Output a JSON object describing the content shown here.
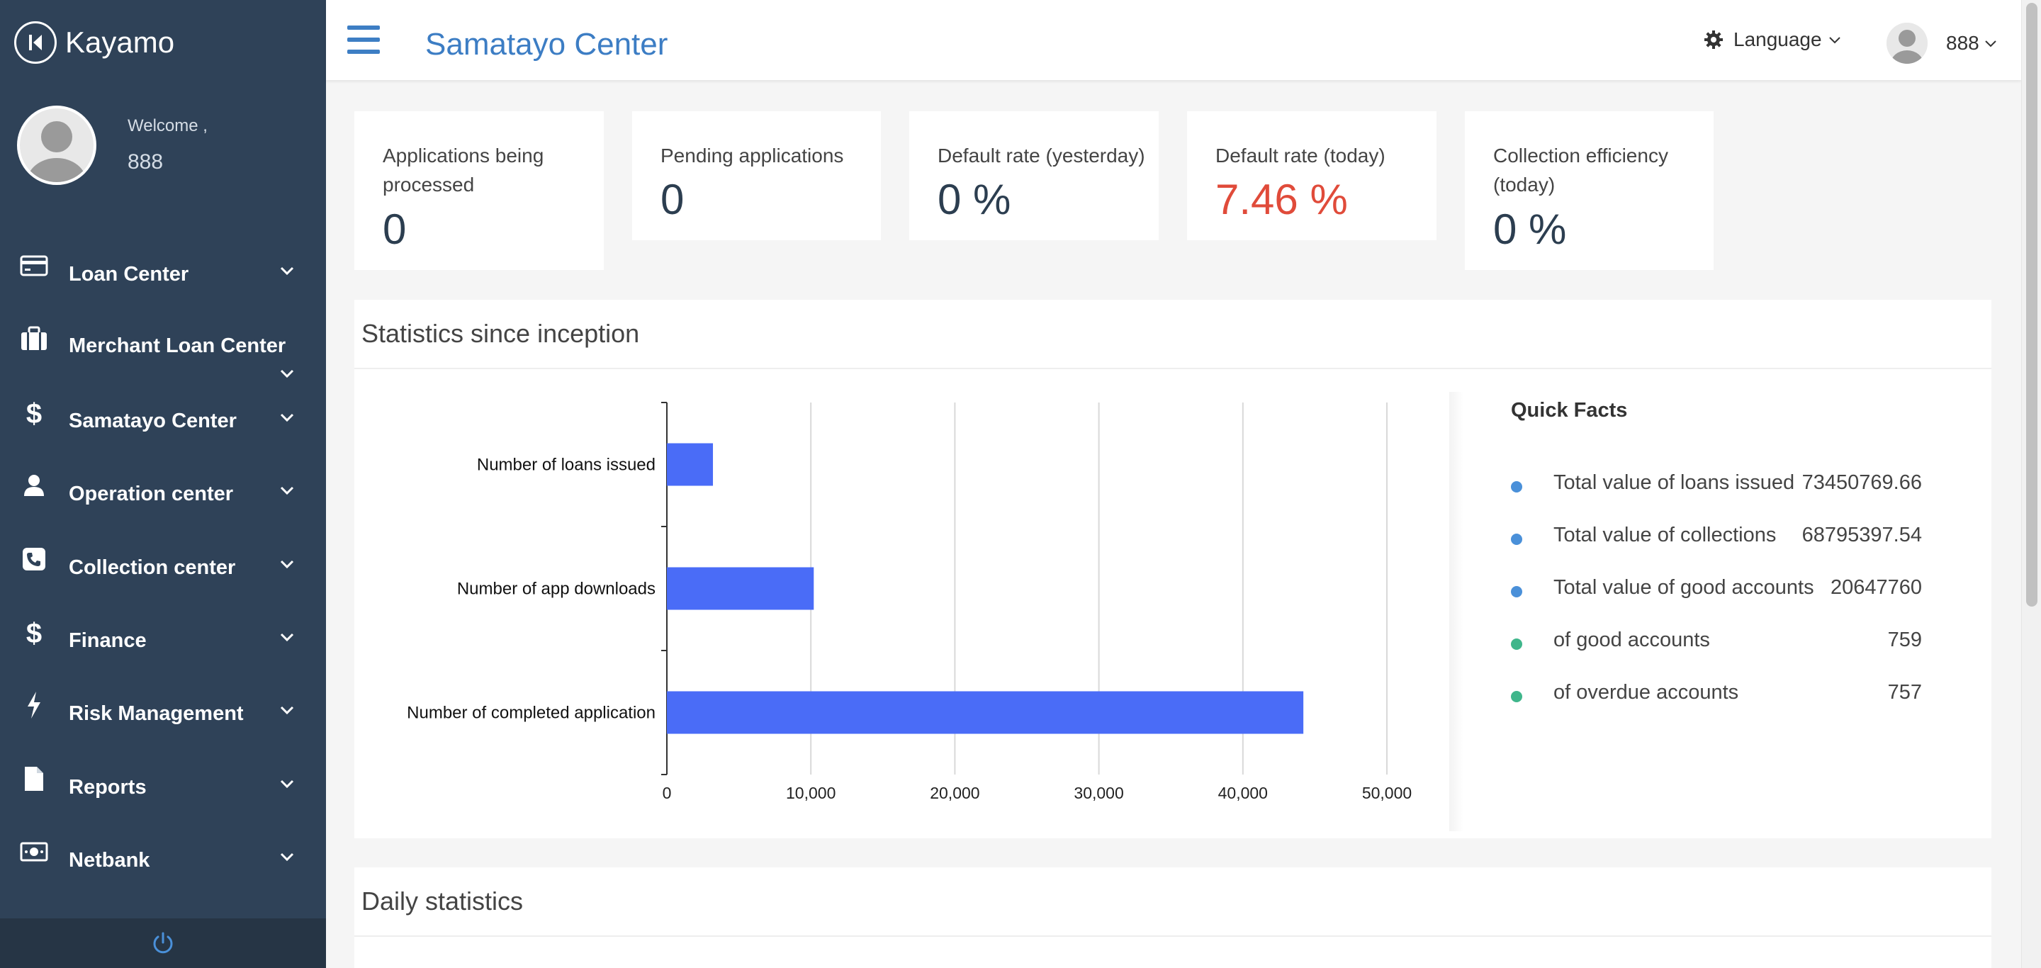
{
  "brand": {
    "name": "Kayamo"
  },
  "profile": {
    "welcome": "Welcome ,",
    "username": "888"
  },
  "sidebar": {
    "items": [
      {
        "label": "Loan Center",
        "icon": "credit-card-icon"
      },
      {
        "label": "Merchant Loan Center",
        "icon": "briefcase-icon"
      },
      {
        "label": "Samatayo Center",
        "icon": "dollar-icon"
      },
      {
        "label": "Operation center",
        "icon": "user-icon"
      },
      {
        "label": "Collection center",
        "icon": "phone-icon"
      },
      {
        "label": "Finance",
        "icon": "dollar-icon"
      },
      {
        "label": "Risk Management",
        "icon": "bolt-icon"
      },
      {
        "label": "Reports",
        "icon": "file-icon"
      },
      {
        "label": "Netbank",
        "icon": "money-icon"
      }
    ]
  },
  "topbar": {
    "title": "Samatayo Center",
    "language_label": "Language",
    "username": "888"
  },
  "cards": [
    {
      "label": "Applications being processed",
      "value": "0"
    },
    {
      "label": "Pending applications",
      "value": "0"
    },
    {
      "label": "Default rate (yesterday)",
      "value": "0 %"
    },
    {
      "label": "Default rate (today)",
      "value": "7.46 %"
    },
    {
      "label": "Collection efficiency (today)",
      "value": "0 %"
    }
  ],
  "stats_panel": {
    "title": "Statistics since inception"
  },
  "daily_panel": {
    "title": "Daily statistics"
  },
  "quick_facts": {
    "title": "Quick Facts",
    "items": [
      {
        "label": "Total value of loans issued",
        "value": "73450769.66",
        "color": "#4a90d9"
      },
      {
        "label": "Total value of collections",
        "value": "68795397.54",
        "color": "#4a90d9"
      },
      {
        "label": "Total value of good accounts",
        "value": "20647760",
        "color": "#4a90d9"
      },
      {
        "label": "of good accounts",
        "value": "759",
        "color": "#3fb68b"
      },
      {
        "label": "of overdue accounts",
        "value": "757",
        "color": "#3fb68b"
      }
    ]
  },
  "colors": {
    "sidebar_bg": "#2f4258",
    "accent": "#3c7dc4",
    "bar": "#4a6cf7",
    "danger": "#e04b3a"
  },
  "chart_data": {
    "type": "bar",
    "orientation": "horizontal",
    "categories": [
      "Number of loans issued",
      "Number of app downloads",
      "Number of completed application"
    ],
    "values": [
      3200,
      10200,
      44200
    ],
    "xlim": [
      0,
      50000
    ],
    "xticks": [
      "0",
      "10,000",
      "20,000",
      "30,000",
      "40,000",
      "50,000"
    ],
    "grid": true,
    "legend": false
  }
}
